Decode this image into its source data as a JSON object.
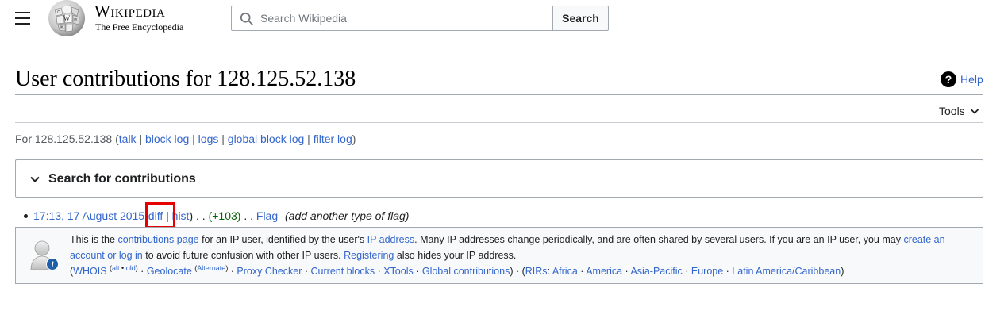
{
  "header": {
    "menu_icon": "hamburger-menu-icon",
    "logo_icon": "wikipedia-globe-icon",
    "wordmark": "Wikipedia",
    "tagline": "The Free Encyclopedia",
    "search_placeholder": "Search Wikipedia",
    "search_icon": "magnifier-icon",
    "search_button": "Search"
  },
  "page": {
    "title": "User contributions for 128.125.52.138",
    "help_icon": "question-circle-icon",
    "help_label": "Help",
    "tools_label": "Tools",
    "tools_icon": "chevron-down-icon"
  },
  "user_links": {
    "prefix": "For 128.125.52.138 (",
    "talk": "talk",
    "block_log": "block log",
    "logs": "logs",
    "global_block_log": "global block log",
    "filter_log": "filter log",
    "suffix": ")",
    "separator": " | "
  },
  "search_panel": {
    "title": "Search for contributions",
    "icon": "chevron-down-icon"
  },
  "contribution": {
    "timestamp": "17:13, 17 August 2015",
    "diff": "diff",
    "hist": "hist",
    "dots": ". .",
    "size_change": "(+103)",
    "page": "Flag",
    "summary": "(add another type of flag)"
  },
  "notice": {
    "icon": "anonymous-user-info-icon",
    "t1": "This is the ",
    "contributions_page": "contributions page",
    "t2": " for an IP user, identified by the user's ",
    "ip_address": "IP address",
    "t3": ". Many IP addresses change periodically, and are often shared by several users. If you are an IP user, you may ",
    "create_account": "create an account or log in",
    "t4": " to avoid future confusion with other IP users. ",
    "registering": "Registering",
    "t5": " also hides your IP address.",
    "whois": "WHOIS",
    "alt": "alt",
    "old": "old",
    "geolocate": "Geolocate",
    "alternate": "Alternate",
    "proxy_checker": "Proxy Checker",
    "current_blocks": "Current blocks",
    "xtools": "XTools",
    "global_contributions": "Global contributions",
    "rirs": "RIRs",
    "africa": "Africa",
    "america": "America",
    "asia_pacific": "Asia-Pacific",
    "europe": "Europe",
    "latin_america": "Latin America/Caribbean"
  }
}
